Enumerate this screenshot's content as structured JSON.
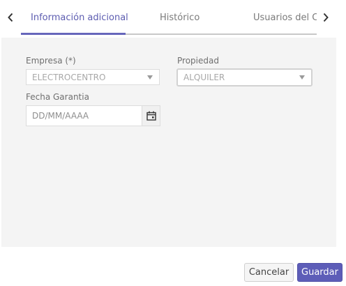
{
  "tabs": {
    "items": [
      {
        "label": "Información adicional",
        "active": true
      },
      {
        "label": "Histórico",
        "active": false
      },
      {
        "label": "Usuarios del CI",
        "active": false
      }
    ],
    "prev_icon": "chevron-left-icon",
    "next_icon": "chevron-right-icon"
  },
  "form": {
    "empresa": {
      "label": "Empresa (*)",
      "value": "ELECTROCENTRO"
    },
    "propiedad": {
      "label": "Propiedad",
      "value": "ALQUILER"
    },
    "fecha_garantia": {
      "label": "Fecha Garantia",
      "placeholder": "DD/MM/AAAA",
      "icon": "calendar-icon"
    }
  },
  "actions": {
    "cancel_label": "Cancelar",
    "save_label": "Guardar"
  },
  "colors": {
    "accent": "#5d5db8",
    "panel_bg": "#f4f4f4"
  }
}
